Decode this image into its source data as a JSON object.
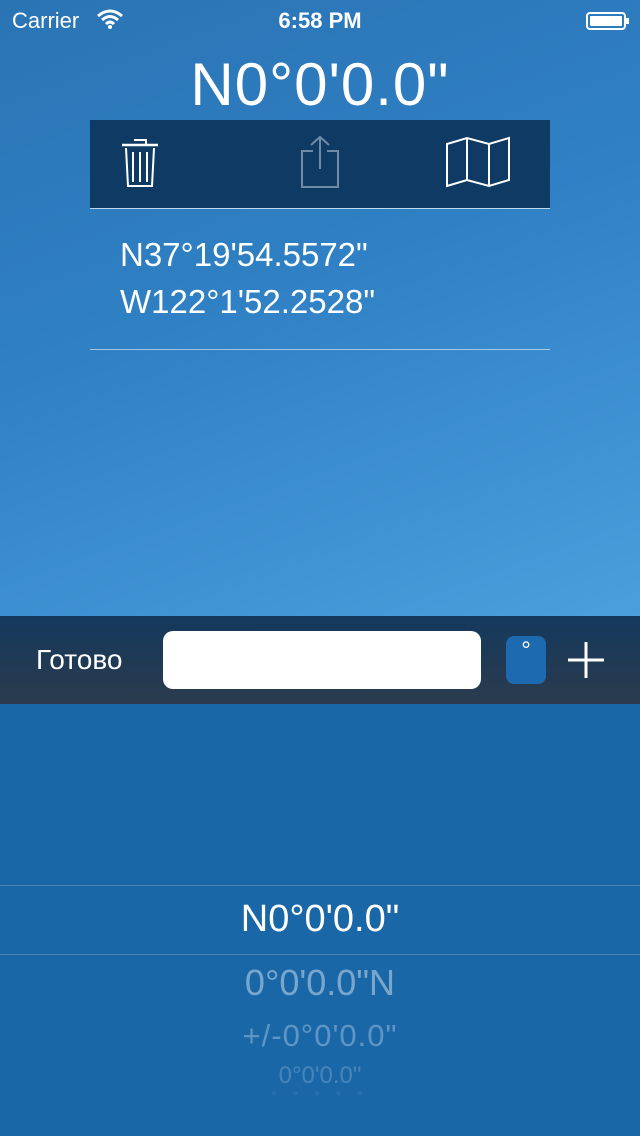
{
  "status_bar": {
    "carrier": "Carrier",
    "time": "6:58 PM",
    "icons": [
      "wifi-icon",
      "battery-icon"
    ]
  },
  "headline": "N0°0'0.0\"",
  "toolbar": {
    "icons": [
      "trash-icon",
      "share-icon",
      "map-icon"
    ]
  },
  "location": {
    "latitude": "N37°19'54.5572\"",
    "longitude": "W122°1'52.2528\""
  },
  "input_bar": {
    "done_label": "Готово",
    "field_value": "",
    "degree_label": "°",
    "add_icon": "plus-icon"
  },
  "picker": {
    "selected": "N0°0'0.0\"",
    "options": [
      "0°0'0.0\"N",
      "+/-0°0'0.0\"",
      "0°0'0.0\"",
      "° ° ° ° °"
    ]
  },
  "colors": {
    "toolbar_bg": "#0f3a63",
    "top_gradient_start": "#2a74b4",
    "top_gradient_end": "#4a9fdc",
    "picker_bg": "#1a67a8"
  }
}
